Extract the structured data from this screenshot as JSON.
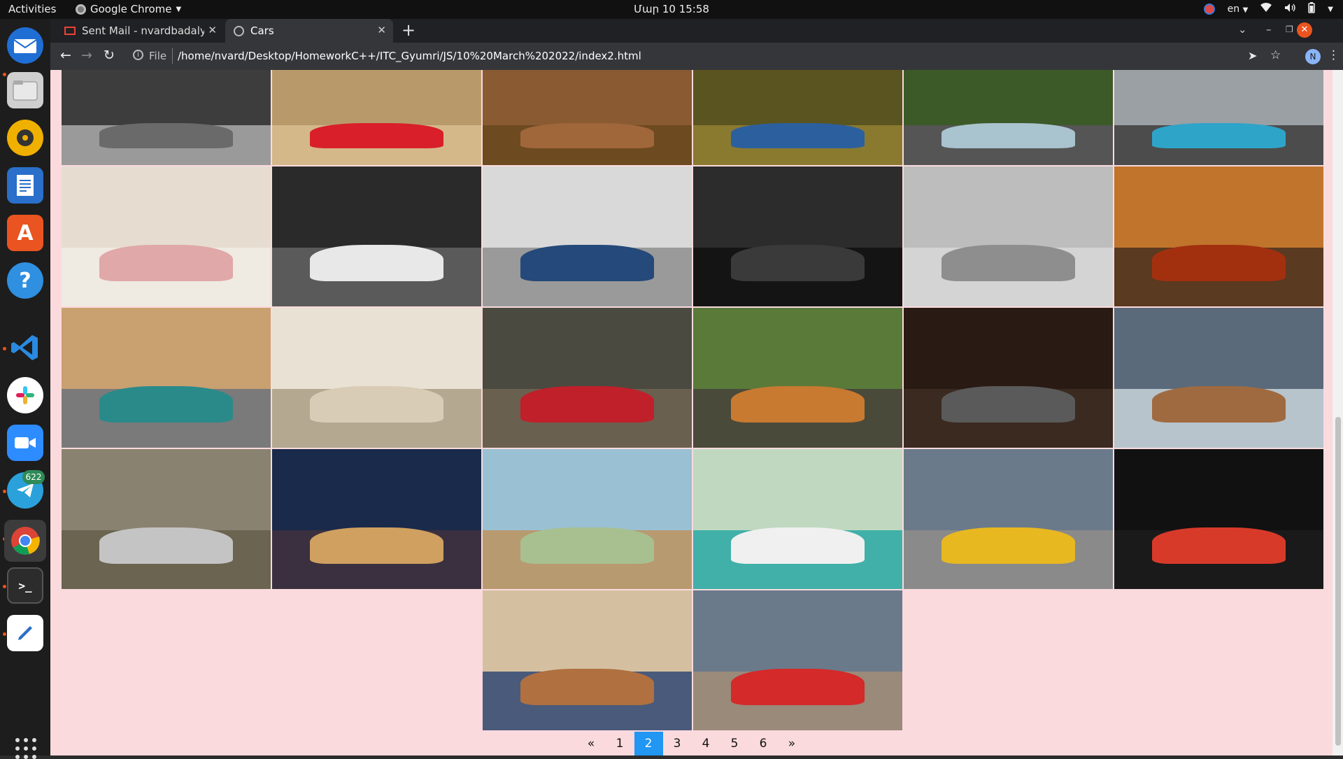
{
  "topbar": {
    "activities": "Activities",
    "app_name": "Google Chrome",
    "clock": "Մար 10  15:58",
    "lang": "en"
  },
  "dock": {
    "telegram_badge": "622",
    "items": [
      "thunderbird-icon",
      "files-icon",
      "rhythmbox-icon",
      "writer-icon",
      "software-icon",
      "help-icon",
      "vscode-icon",
      "slack-icon",
      "zoom-icon",
      "telegram-icon",
      "chrome-icon",
      "terminal-icon",
      "text-editor-icon"
    ]
  },
  "browser": {
    "tabs": [
      {
        "title": "Sent Mail - nvardbadalyan",
        "icon": "gmail-icon"
      },
      {
        "title": "Cars",
        "icon": "globe-icon"
      }
    ],
    "address_prefix": "File",
    "url": "/home/nvard/Desktop/HomeworkC++/ITC_Gyumri/JS/10%20March%202022/index2.html",
    "avatar_letter": "N"
  },
  "gallery": {
    "rows": [
      [
        {
          "bg": "#3d3d3d",
          "fg": "#9a9a9a",
          "car": "#6a6a6a"
        },
        {
          "bg": "#b89a6a",
          "fg": "#d4b88a",
          "car": "#d81f2a"
        },
        {
          "bg": "#8a5a32",
          "fg": "#6d4a20",
          "car": "#a0673a"
        },
        {
          "bg": "#5a5420",
          "fg": "#8a7a30",
          "car": "#2c5f9e"
        },
        {
          "bg": "#3c5a28",
          "fg": "#555",
          "car": "#a9c3cf"
        },
        {
          "bg": "#9aa0a4",
          "fg": "#4c4c4c",
          "car": "#2ea4c9"
        }
      ],
      [
        {
          "bg": "#e6ddd0",
          "fg": "#efeae2",
          "car": "#e0a8a8"
        },
        {
          "bg": "#2a2a2a",
          "fg": "#5a5a5a",
          "car": "#e8e8e8"
        },
        {
          "bg": "#d9d9d9",
          "fg": "#9a9a9a",
          "car": "#24497a"
        },
        {
          "bg": "#2c2c2c",
          "fg": "#141414",
          "car": "#3a3a3a"
        },
        {
          "bg": "#bdbdbd",
          "fg": "#d4d4d4",
          "car": "#8e8e8e"
        },
        {
          "bg": "#c0742c",
          "fg": "#5a3a20",
          "car": "#a2300f"
        }
      ],
      [
        {
          "bg": "#c9a070",
          "fg": "#7a7a7a",
          "car": "#2a8a8a"
        },
        {
          "bg": "#e9e2d4",
          "fg": "#b4a890",
          "car": "#d8ccb6"
        },
        {
          "bg": "#4a4a40",
          "fg": "#6a6050",
          "car": "#c0202a"
        },
        {
          "bg": "#5a7a3a",
          "fg": "#4a4a3a",
          "car": "#c87a30"
        },
        {
          "bg": "#2a1a14",
          "fg": "#3a2a20",
          "car": "#5a5a5a"
        },
        {
          "bg": "#5a6a7a",
          "fg": "#b8c4cc",
          "car": "#a06a40"
        }
      ],
      [
        {
          "bg": "#8a8270",
          "fg": "#6a6450",
          "car": "#c4c4c4"
        },
        {
          "bg": "#1a2a4a",
          "fg": "#3a3040",
          "car": "#d0a060"
        },
        {
          "bg": "#9ac0d4",
          "fg": "#b89a70",
          "car": "#a8c090"
        },
        {
          "bg": "#c0d8c0",
          "fg": "#40b0a8",
          "car": "#f0f0f0"
        },
        {
          "bg": "#6a7a8a",
          "fg": "#8a8a8a",
          "car": "#e8b820"
        },
        {
          "bg": "#111111",
          "fg": "#1a1a1a",
          "car": "#d83a2a"
        }
      ],
      [
        {
          "bg": "#d4c0a0",
          "fg": "#4a5a7a",
          "car": "#b07040"
        },
        {
          "bg": "#6a7a8a",
          "fg": "#9a8a7a",
          "car": "#d42a2a"
        }
      ]
    ]
  },
  "pagination": {
    "prev": "«",
    "pages": [
      "1",
      "2",
      "3",
      "4",
      "5",
      "6"
    ],
    "active": "2",
    "next": "»"
  }
}
